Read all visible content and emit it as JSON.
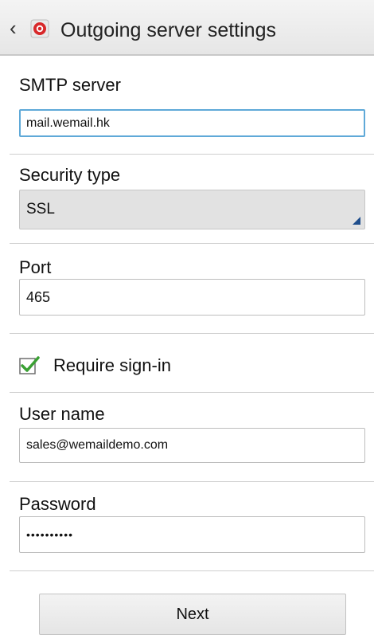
{
  "header": {
    "back_icon": "chevron-left-icon",
    "app_icon": "email-app-icon",
    "title": "Outgoing server settings"
  },
  "smtp": {
    "label": "SMTP server",
    "value": "mail.wemail.hk"
  },
  "security": {
    "label": "Security type",
    "value": "SSL"
  },
  "port": {
    "label": "Port",
    "value": "465"
  },
  "signin": {
    "label": "Require sign-in",
    "checked": true
  },
  "username": {
    "label": "User name",
    "value": "sales@wemaildemo.com"
  },
  "password": {
    "label": "Password",
    "value": "••••••••••"
  },
  "next_button": {
    "label": "Next"
  },
  "colors": {
    "focus_border": "#5fa9d8",
    "check_green": "#3aa033",
    "select_arrow": "#1f4e8c",
    "app_icon_red": "#d8282a"
  }
}
